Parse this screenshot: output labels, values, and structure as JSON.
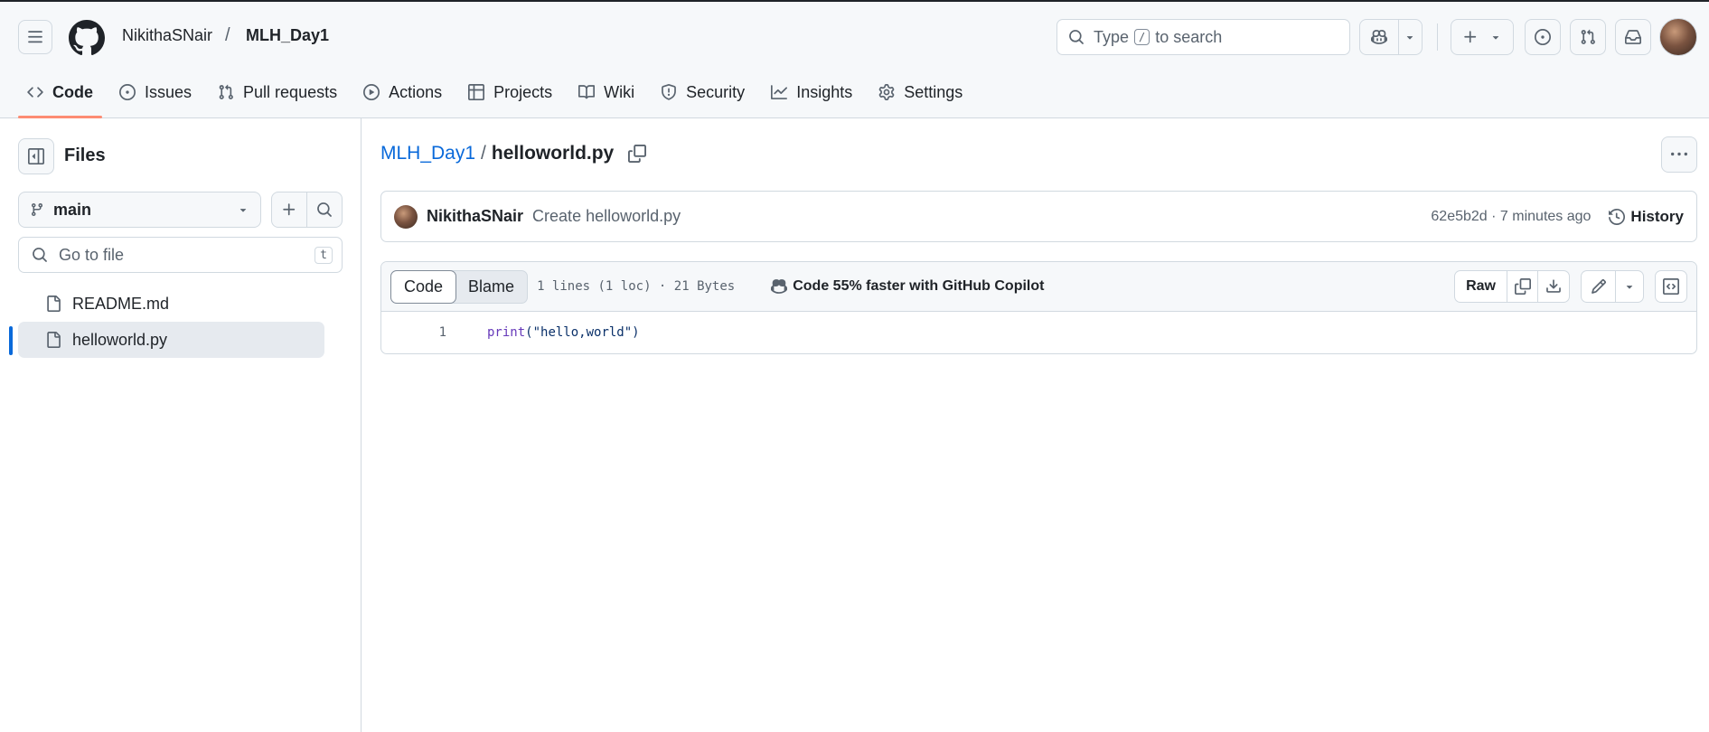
{
  "header": {
    "owner": "NikithaSNair",
    "separator": "/",
    "repo": "MLH_Day1",
    "search": {
      "prefix": "Type",
      "key": "/",
      "suffix": "to search"
    }
  },
  "nav": {
    "items": [
      {
        "label": "Code",
        "icon": "code-icon",
        "active": true
      },
      {
        "label": "Issues",
        "icon": "issue-opened-icon"
      },
      {
        "label": "Pull requests",
        "icon": "git-pull-request-icon"
      },
      {
        "label": "Actions",
        "icon": "play-icon"
      },
      {
        "label": "Projects",
        "icon": "table-icon"
      },
      {
        "label": "Wiki",
        "icon": "book-icon"
      },
      {
        "label": "Security",
        "icon": "shield-icon"
      },
      {
        "label": "Insights",
        "icon": "graph-icon"
      },
      {
        "label": "Settings",
        "icon": "gear-icon"
      }
    ]
  },
  "sidebar": {
    "title": "Files",
    "branch": "main",
    "goto_placeholder": "Go to file",
    "goto_shortcut": "t",
    "files": [
      {
        "name": "README.md",
        "selected": false
      },
      {
        "name": "helloworld.py",
        "selected": true
      }
    ]
  },
  "breadcrumb": {
    "repo": "MLH_Day1",
    "sep": "/",
    "file": "helloworld.py"
  },
  "commit": {
    "author": "NikithaSNair",
    "message": "Create helloworld.py",
    "meta": "62e5b2d · 7 minutes ago",
    "history_label": "History"
  },
  "file": {
    "tab_code": "Code",
    "tab_blame": "Blame",
    "stats": "1 lines (1 loc) · 21 Bytes",
    "copilot_hint": "Code 55% faster with GitHub Copilot",
    "raw_label": "Raw",
    "lines": [
      {
        "number": "1",
        "fn": "print",
        "rest": "(\"hello,world\")"
      }
    ]
  },
  "colors": {
    "accent": "#0969da",
    "active_underline": "#fd8c73",
    "header_bg": "#f6f8fa",
    "border": "#d1d9e0"
  }
}
